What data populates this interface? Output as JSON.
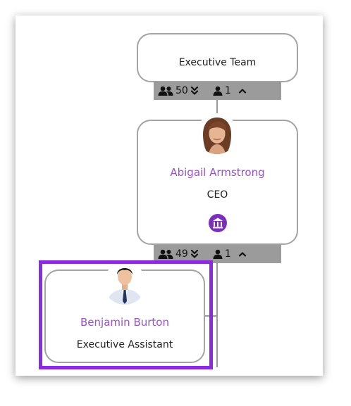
{
  "team_node": {
    "title": "Executive Team",
    "stats": {
      "members": "50",
      "direct": "1"
    }
  },
  "ceo_node": {
    "name": "Abigail Armstrong",
    "role": "CEO",
    "badge_icon": "bank-icon",
    "stats": {
      "members": "49",
      "direct": "1"
    }
  },
  "assistant_node": {
    "name": "Benjamin Burton",
    "role": "Executive Assistant"
  },
  "colors": {
    "accent": "#9a4fd6",
    "badge": "#7b2fbe",
    "highlight": "#8a2be2",
    "bar": "#9b9b9b"
  }
}
